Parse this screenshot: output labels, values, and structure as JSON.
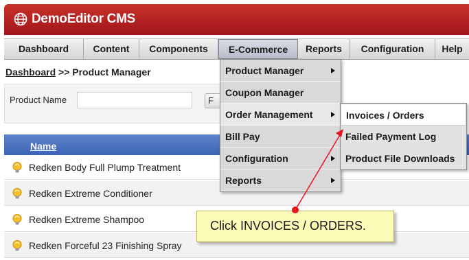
{
  "app": {
    "title": "DemoEditor CMS",
    "brand_color": "#b1211f"
  },
  "nav": {
    "tabs": [
      {
        "label": "Dashboard"
      },
      {
        "label": "Content"
      },
      {
        "label": "Components"
      },
      {
        "label": "E-Commerce"
      },
      {
        "label": "Reports"
      },
      {
        "label": "Configuration"
      },
      {
        "label": "Help"
      }
    ],
    "active_tab": "E-Commerce"
  },
  "breadcrumb": {
    "link": "Dashboard",
    "separator": ">>",
    "current": "Product Manager"
  },
  "filter": {
    "label": "Product Name",
    "value": "",
    "button_label": "F"
  },
  "table": {
    "header": "Name",
    "header_color": "#4a73c1",
    "rows": [
      {
        "name": "Redken Body Full Plump Treatment"
      },
      {
        "name": "Redken Extreme Conditioner"
      },
      {
        "name": "Redken Extreme Shampoo"
      },
      {
        "name": "Redken Forceful 23 Finishing Spray"
      }
    ],
    "row_icon": "lightbulb-icon"
  },
  "ecommerce_menu": {
    "items": [
      {
        "label": "Product Manager",
        "has_submenu": true
      },
      {
        "label": "Coupon Manager",
        "has_submenu": false
      },
      {
        "label": "Order Management",
        "has_submenu": true
      },
      {
        "label": "Bill Pay",
        "has_submenu": false
      },
      {
        "label": "Configuration",
        "has_submenu": true
      },
      {
        "label": "Reports",
        "has_submenu": true
      }
    ]
  },
  "order_submenu": {
    "items": [
      {
        "label": "Invoices / Orders"
      },
      {
        "label": "Failed Payment Log"
      },
      {
        "label": "Product File Downloads"
      }
    ]
  },
  "callout": {
    "text": "Click INVOICES / ORDERS.",
    "bg_color": "#fdfbb8",
    "arrow_color": "#e8141e"
  }
}
